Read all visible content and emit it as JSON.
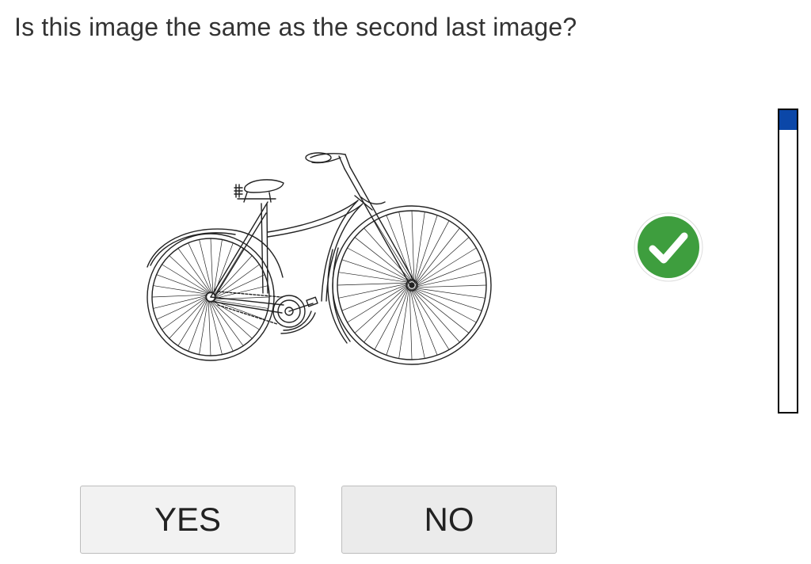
{
  "question": "Is this image the same as the second last image?",
  "stimulus": {
    "subject": "bicycle-image"
  },
  "feedback": {
    "icon": "check-circle-icon",
    "color": "#3e9e3e"
  },
  "progress": {
    "fraction": 0.065,
    "fill_color": "#0b47a8"
  },
  "buttons": {
    "yes_label": "YES",
    "no_label": "NO"
  }
}
